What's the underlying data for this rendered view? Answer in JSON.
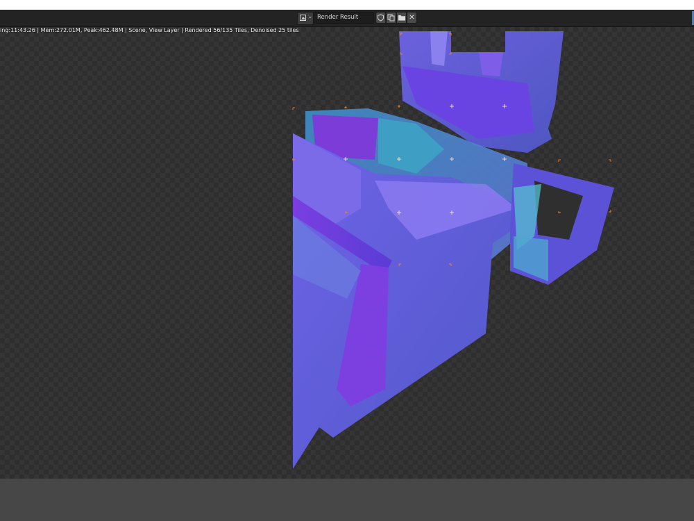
{
  "header": {
    "image_type_icon": "image-icon",
    "image_name": "Render Result",
    "icons": {
      "fake_user": "shield-icon",
      "new_image": "duplicate-icon",
      "open_image": "folder-icon",
      "unlink": "close-icon"
    },
    "unlink_glyph": "✕"
  },
  "viewport": {
    "render_stats": "ing:11:43.26 | Mem:272.01M, Peak:462.48M | Scene, View Layer | Rendered 56/135 Tiles, Denoised 25 tiles"
  },
  "colors": {
    "header_bg": "#232323",
    "viewport_bg": "#2e2e2e",
    "checker": "#353535",
    "bottom_bg": "#474747",
    "tile_marker": "#e8872a"
  }
}
